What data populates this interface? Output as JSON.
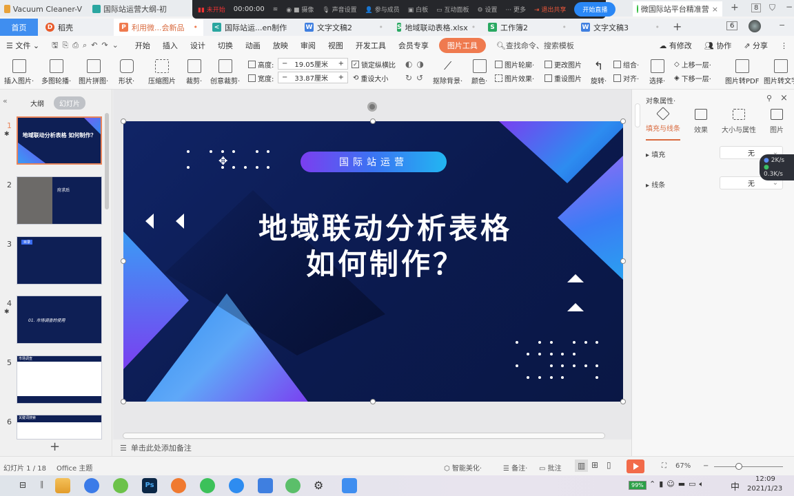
{
  "browser": {
    "tabs": [
      {
        "label": "Vacuum Cleaner-V",
        "color": "#e8a23a"
      },
      {
        "label": "国际站运营大纲-初",
        "color": "#2aa6a0"
      },
      {
        "label": "微国际站平台精准营",
        "color": "#2dbb3a"
      }
    ],
    "new_tab": "+",
    "tab_count": "8"
  },
  "meeting_bar": {
    "status": "未开始",
    "timer": "00:00:00",
    "items": [
      "摄像",
      "声音设置",
      "参与成员",
      "白板",
      "互动面板",
      "设置",
      "··· 更多"
    ],
    "exit_label": "退出共享",
    "start_label": "开始直播"
  },
  "wps_tabs": {
    "home": "首页",
    "tabs": [
      {
        "label": "稻壳",
        "icon": "D",
        "color": "#e85a2a",
        "dot": ""
      },
      {
        "label": "利用微...会新品",
        "icon": "P",
        "color": "#ef7a4f",
        "dot": "•",
        "active": true
      },
      {
        "label": "国际站运...en制作",
        "icon": "<",
        "color": "#2aa6a0",
        "dot": ""
      },
      {
        "label": "文字文稿2",
        "icon": "W",
        "color": "#3f7fe0",
        "dot": "•"
      },
      {
        "label": "地域联动表格.xlsx",
        "icon": "S",
        "color": "#29a861",
        "dot": "•"
      },
      {
        "label": "工作簿2",
        "icon": "S",
        "color": "#29a861",
        "dot": "•"
      },
      {
        "label": "文字文稿3",
        "icon": "W",
        "color": "#3f7fe0",
        "dot": "•"
      }
    ],
    "add": "+",
    "window_count": "6"
  },
  "menu": {
    "file": "文件",
    "items": [
      "开始",
      "插入",
      "设计",
      "切换",
      "动画",
      "放映",
      "审阅",
      "视图",
      "开发工具",
      "会员专享"
    ],
    "picture_tools": "图片工具",
    "search": "查找命令、搜索模板",
    "right": [
      "有修改",
      "协作",
      "分享"
    ]
  },
  "ribbon": {
    "big": [
      "插入图片·",
      "多图轮播·",
      "图片拼图·",
      "形状·",
      "压缩图片",
      "裁剪·",
      "创意裁剪·"
    ],
    "height_label": "高度:",
    "height_value": "19.05厘米",
    "width_label": "宽度:",
    "width_value": "33.87厘米",
    "lock_ratio": "锁定纵横比",
    "reset_size": "重设大小",
    "remove_bg": "抠除背景·",
    "color": "颜色·",
    "outline": "图片轮廓·",
    "effect": "图片效果·",
    "change_pic": "更改图片",
    "reset_pic": "重设图片",
    "rotate": "旋转·",
    "group": "组合·",
    "align": "对齐·",
    "select": "选择·",
    "up": "上移一层·",
    "down": "下移一层·",
    "to_pdf": "图片转PDF",
    "to_text": "图片转文字"
  },
  "left_panel": {
    "outline_tab": "大纲",
    "slides_tab": "幻灯片",
    "slides": [
      {
        "num": "1",
        "title": "地域联动分析表格 如何制作？",
        "starred": true
      },
      {
        "num": "2",
        "title": "府求后",
        "starred": false
      },
      {
        "num": "3",
        "title": "目录",
        "starred": false
      },
      {
        "num": "4",
        "title": "01. 市场调查的使用",
        "starred": true
      },
      {
        "num": "5",
        "title": "市场调查",
        "starred": false
      },
      {
        "num": "6",
        "title": "关键词搜索",
        "starred": false
      }
    ],
    "add": "+"
  },
  "slide": {
    "tag": "国际站运营",
    "title_line1": "地域联动分析表格",
    "title_line2": "如何制作？"
  },
  "notes_placeholder": "单击此处添加备注",
  "right_panel": {
    "title": "对象属性·",
    "tabs": [
      "填充与线条",
      "效果",
      "大小与属性",
      "图片"
    ],
    "fill_label": "填充",
    "fill_value": "无",
    "line_label": "线条",
    "line_value": "无"
  },
  "net_speed": {
    "up": "2K/s",
    "down": "0.3K/s"
  },
  "status": {
    "slide_index": "幻灯片 1 / 18",
    "theme": "Office 主题",
    "beautify": "智能美化·",
    "notes": "备注·",
    "comments": "批注",
    "zoom": "67%"
  },
  "taskbar": {
    "battery": "99%",
    "ime": "中",
    "time": "12:09",
    "date": "2021/1/23"
  }
}
